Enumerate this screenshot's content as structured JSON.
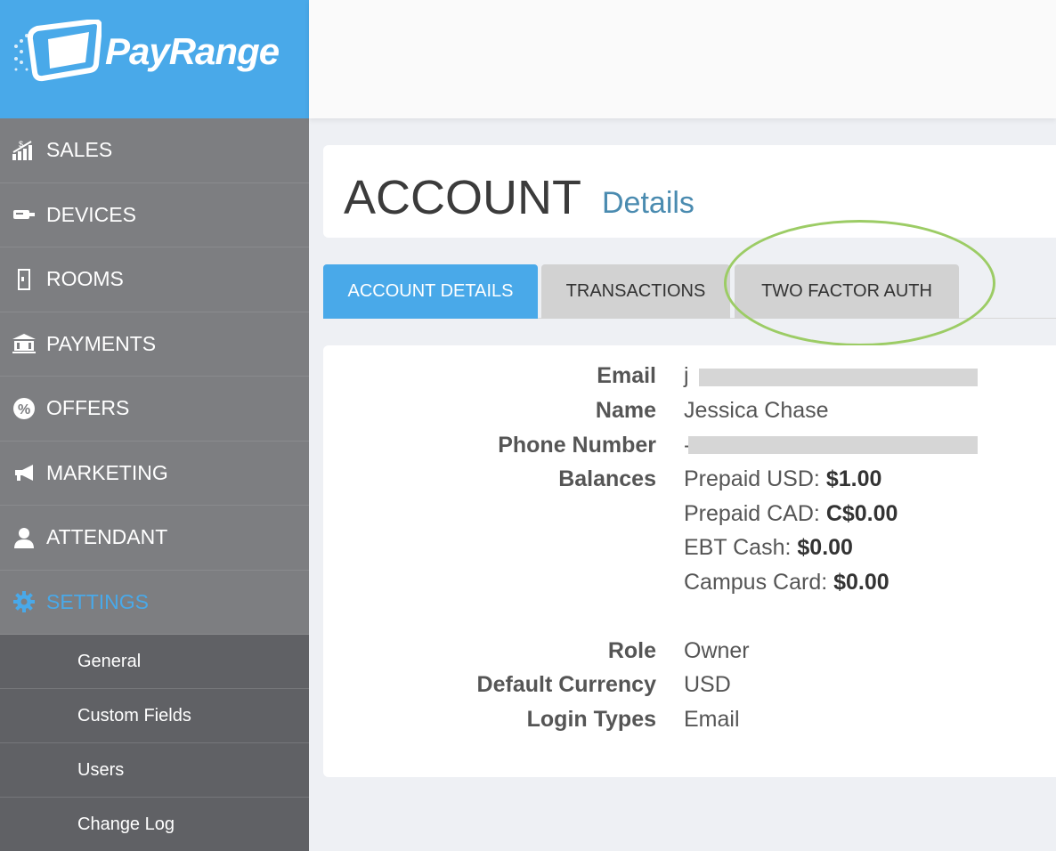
{
  "brand": {
    "name": "PayRange",
    "logo_color": "#49a9e9"
  },
  "sidebar": {
    "items": [
      {
        "label": "SALES",
        "icon": "sales-chart-icon"
      },
      {
        "label": "DEVICES",
        "icon": "device-icon"
      },
      {
        "label": "ROOMS",
        "icon": "door-icon"
      },
      {
        "label": "PAYMENTS",
        "icon": "bank-icon"
      },
      {
        "label": "OFFERS",
        "icon": "percent-badge-icon"
      },
      {
        "label": "MARKETING",
        "icon": "megaphone-icon"
      },
      {
        "label": "ATTENDANT",
        "icon": "person-icon"
      },
      {
        "label": "SETTINGS",
        "icon": "gear-icon",
        "active": true
      }
    ],
    "sub_items": [
      "General",
      "Custom Fields",
      "Users",
      "Change Log"
    ]
  },
  "header": {
    "title": "ACCOUNT",
    "subtitle": "Details"
  },
  "tabs": [
    {
      "label": "ACCOUNT DETAILS",
      "active": true
    },
    {
      "label": "TRANSACTIONS",
      "active": false
    },
    {
      "label": "TWO FACTOR AUTH",
      "active": false
    }
  ],
  "details": {
    "email_label": "Email",
    "email_value_prefix": "j",
    "name_label": "Name",
    "name_value": "Jessica Chase",
    "phone_label": "Phone Number",
    "phone_value_prefix": "-",
    "balances_label": "Balances",
    "balances": [
      {
        "name": "Prepaid USD:",
        "amount": "$1.00"
      },
      {
        "name": "Prepaid CAD:",
        "amount": "C$0.00"
      },
      {
        "name": "EBT Cash:",
        "amount": "$0.00"
      },
      {
        "name": "Campus Card:",
        "amount": "$0.00"
      }
    ],
    "role_label": "Role",
    "role_value": "Owner",
    "currency_label": "Default Currency",
    "currency_value": "USD",
    "login_label": "Login Types",
    "login_value": "Email"
  },
  "colors": {
    "accent": "#49a9e9",
    "sidebar": "#7d7e81",
    "highlight": "#9ccc65"
  }
}
